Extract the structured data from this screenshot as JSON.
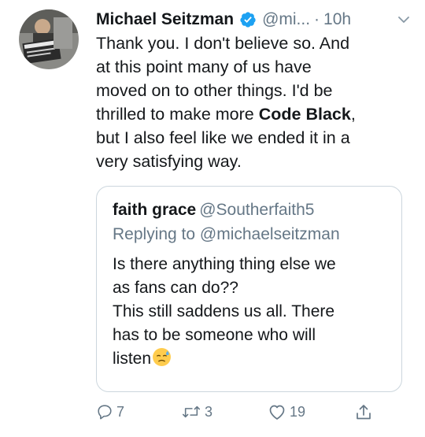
{
  "tweet": {
    "author_name": "Michael Seitzman",
    "handle": "@mi...",
    "separator": "·",
    "time": "10h",
    "text_lines": [
      "Thank you. I don't believe so. And",
      "at this point many of us have",
      "moved on to other things.  I'd be",
      "thrilled to make more ",
      "but I also feel like we ended it in a",
      "very satisfying way."
    ],
    "bold_term": "Code Black",
    "bold_suffix": ","
  },
  "quoted": {
    "name": "faith grace",
    "handle": "@Southerfaith5",
    "replying_label": "Replying to",
    "replying_to": "@michaelseitzman",
    "text_lines": [
      "Is there anything thing else we",
      "as fans can do??",
      "This still saddens us all. There",
      "has to be someone who will",
      "listen"
    ],
    "emoji": "downcast-face-with-sweat"
  },
  "actions": {
    "reply_count": "7",
    "retweet_count": "3",
    "like_count": "19"
  },
  "colors": {
    "text": "#14171a",
    "secondary": "#657786",
    "verified": "#1da1f2",
    "border": "#ccd6dd"
  },
  "icons": [
    "verified-badge-icon",
    "chevron-down-icon",
    "reply-icon",
    "retweet-icon",
    "like-icon",
    "share-icon"
  ]
}
